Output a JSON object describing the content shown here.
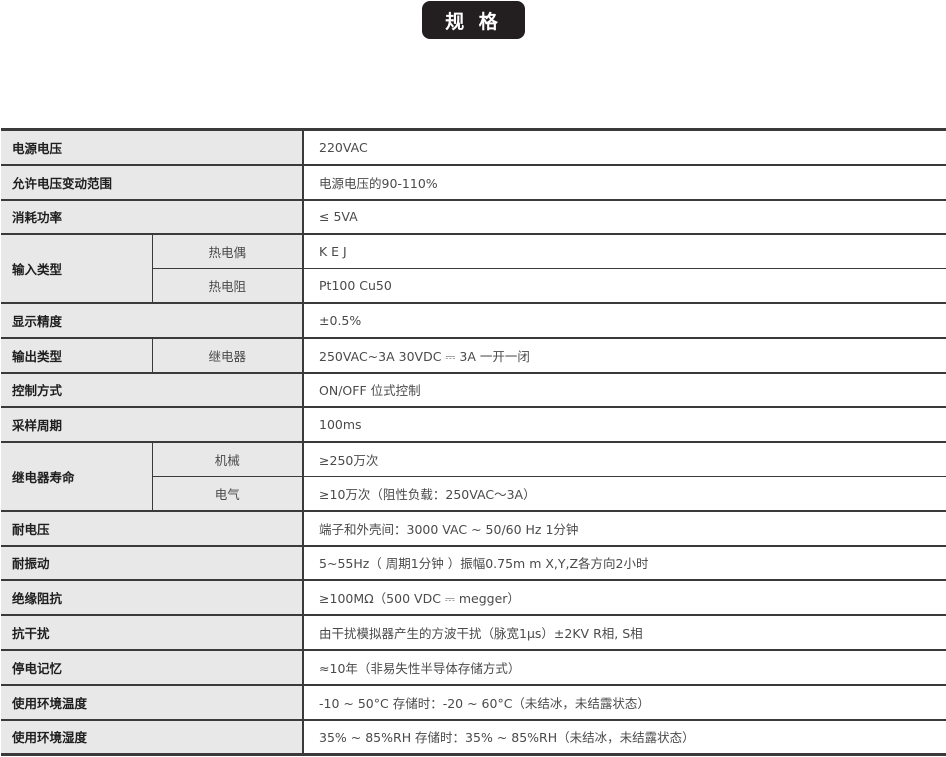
{
  "title": "规 格",
  "rows": [
    {
      "label": "电源电压",
      "value": "220VAC"
    },
    {
      "label": "允许电压变动范围",
      "value": "电源电压的90-110%"
    },
    {
      "label": "消耗功率",
      "value": "≤ 5VA"
    },
    {
      "label": "输入类型",
      "subs": [
        {
          "label": "热电偶",
          "value": "K   E   J"
        },
        {
          "label": "热电阻",
          "value": "Pt100  Cu50"
        }
      ]
    },
    {
      "label": "显示精度",
      "value": "±0.5%"
    },
    {
      "label": "输出类型",
      "subs": [
        {
          "label": "继电器",
          "value": "250VAC~3A 30VDC ⎓ 3A 一开一闭"
        }
      ]
    },
    {
      "label": "控制方式",
      "value": "ON/OFF 位式控制"
    },
    {
      "label": "采样周期",
      "value": "100ms"
    },
    {
      "label": "继电器寿命",
      "subs": [
        {
          "label": "机械",
          "value": "≥250万次"
        },
        {
          "label": "电气",
          "value": "≥10万次（阻性负载：250VAC～3A）"
        }
      ]
    },
    {
      "label": "耐电压",
      "value": "端子和外壳间：3000 VAC ~ 50/60 Hz 1分钟"
    },
    {
      "label": "耐振动",
      "value": "5~55Hz（ 周期1分钟 ）振幅0.75m m X,Y,Z各方向2小时"
    },
    {
      "label": "绝缘阻抗",
      "value": "≥100MΩ（500 VDC ⎓ megger）"
    },
    {
      "label": "抗干扰",
      "value": "由干扰模拟器产生的方波干扰（脉宽1μs）±2KV R相, S相"
    },
    {
      "label": "停电记忆",
      "value": "≈10年（非易失性半导体存储方式）"
    },
    {
      "label": "使用环境温度",
      "value": "-10 ~ 50°C 存储时：-20 ~ 60°C（未结冰，未结露状态）"
    },
    {
      "label": "使用环境湿度",
      "value": "35%  ~ 85%RH 存储时：35%  ~ 85%RH（未结冰，未结露状态）"
    }
  ]
}
